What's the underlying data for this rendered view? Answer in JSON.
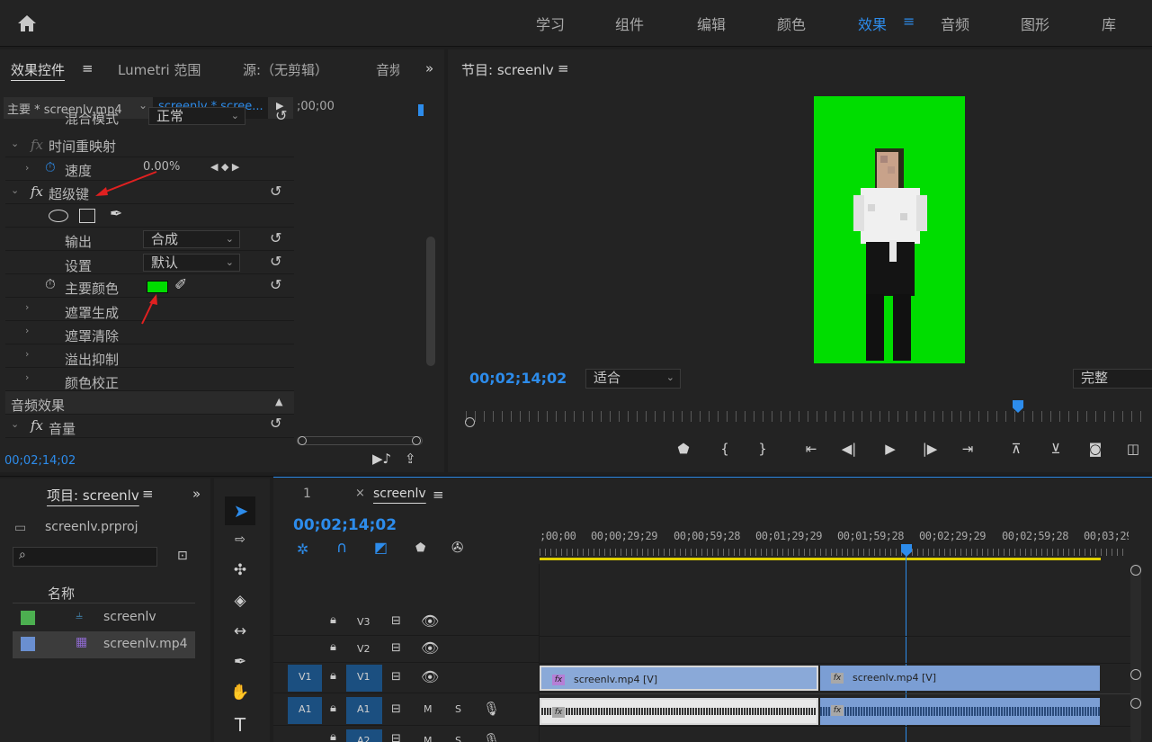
{
  "topbar": {
    "workspaces": [
      "学习",
      "组件",
      "编辑",
      "颜色",
      "效果",
      "音频",
      "图形",
      "库"
    ],
    "active": "效果",
    "menu_icon": "≡"
  },
  "effect_controls": {
    "tabs": [
      "效果控件",
      "Lumetri 范围",
      "源:（无剪辑）",
      "音频"
    ],
    "overflow": "»",
    "header": {
      "master": "主要 * screenlv.mp4",
      "clip": "screenlv * scree...",
      "timecode": ";00;00"
    },
    "blend_label": "混合模式",
    "blend_value": "正常",
    "time_remap": "时间重映射",
    "speed_label": "速度",
    "speed_value": "0.00%",
    "ultrakey": "超级键",
    "output_label": "输出",
    "output_value": "合成",
    "setting_label": "设置",
    "setting_value": "默认",
    "key_color_label": "主要颜色",
    "key_color": "#00dd00",
    "subs": [
      "遮罩生成",
      "遮罩清除",
      "溢出抑制",
      "颜色校正"
    ],
    "audio_effects": "音频效果",
    "volume": "音量",
    "footer_timecode": "00;02;14;02"
  },
  "program": {
    "title": "节目: screenlv",
    "timecode": "00;02;14;02",
    "fit": "适合",
    "quality": "完整",
    "green": "#00dd00",
    "playhead_fraction": 0.75
  },
  "project": {
    "title": "项目: screenlv",
    "file": "screenlv.prproj",
    "col_name": "名称",
    "items": [
      {
        "name": "screenlv",
        "color": "#4caf50"
      },
      {
        "name": "screenlv.mp4",
        "color": "#6a8fd0"
      }
    ]
  },
  "timeline": {
    "tab_num": "1",
    "tab": "screenlv",
    "timecode": "00;02;14;02",
    "ruler": [
      ";00;00",
      "00;00;29;29",
      "00;00;59;28",
      "00;01;29;29",
      "00;01;59;28",
      "00;02;29;29",
      "00;02;59;28",
      "00;03;29"
    ],
    "tracks": {
      "v3": "V3",
      "v2": "V2",
      "v1": "V1",
      "a1": "A1",
      "a2": "A2"
    },
    "m": "M",
    "s": "S",
    "clip1": "screenlv.mp4 [V]",
    "clip2": "screenlv.mp4 [V]"
  }
}
